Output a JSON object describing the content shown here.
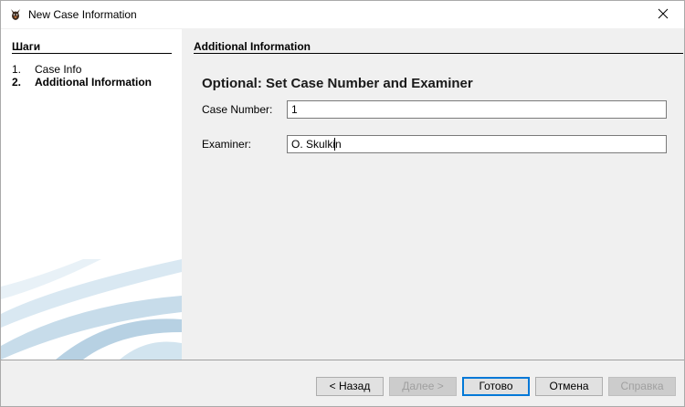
{
  "window": {
    "title": "New Case Information",
    "icon": "app-dog-icon",
    "close_icon": "close-icon"
  },
  "sidebar": {
    "title": "Шаги",
    "steps": [
      {
        "num": "1.",
        "label": "Case Info",
        "active": false
      },
      {
        "num": "2.",
        "label": "Additional Information",
        "active": true
      }
    ]
  },
  "content": {
    "panel_title": "Additional Information",
    "heading": "Optional: Set Case Number and Examiner",
    "fields": {
      "case_number": {
        "label": "Case Number:",
        "value": "1"
      },
      "examiner": {
        "label": "Examiner:",
        "value": "O. Skulkin"
      }
    }
  },
  "buttons": {
    "back": "< Назад",
    "next": "Далее >",
    "finish": "Готово",
    "cancel": "Отмена",
    "help": "Справка"
  },
  "colors": {
    "accent": "#0078d7",
    "swoosh": "#c7dcea"
  }
}
